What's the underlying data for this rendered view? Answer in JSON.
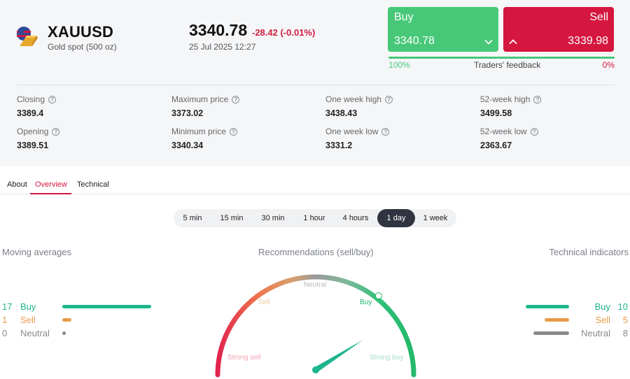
{
  "instrument": {
    "symbol": "XAUUSD",
    "subtitle": "Gold spot (500 oz)",
    "icon": "gold-bar-us-flag-icon"
  },
  "quote": {
    "price": "3340.78",
    "change": "-28.42 (-0.01%)",
    "timestamp": "25 Jul 2025 12:27"
  },
  "trade": {
    "buy_label": "Buy",
    "buy_price": "3340.78",
    "sell_label": "Sell",
    "sell_price": "3339.98"
  },
  "feedback": {
    "buy_percent": "100%",
    "label": "Traders' feedback",
    "sell_percent": "0%",
    "buy_fraction": 1.0
  },
  "stats": [
    {
      "label": "Closing",
      "value": "3389.4"
    },
    {
      "label": "Maximum price",
      "value": "3373.02"
    },
    {
      "label": "One week high",
      "value": "3438.43"
    },
    {
      "label": "52-week high",
      "value": "3499.58"
    },
    {
      "label": "Opening",
      "value": "3389.51"
    },
    {
      "label": "Minimum price",
      "value": "3340.34"
    },
    {
      "label": "One week low",
      "value": "3331.2"
    },
    {
      "label": "52-week low",
      "value": "2363.67"
    }
  ],
  "tabs": [
    {
      "label": "About"
    },
    {
      "label": "Overview",
      "active": true
    },
    {
      "label": "Technical"
    }
  ],
  "periods": [
    {
      "label": "5 min"
    },
    {
      "label": "15 min"
    },
    {
      "label": "30 min"
    },
    {
      "label": "1 hour"
    },
    {
      "label": "4 hours"
    },
    {
      "label": "1 day",
      "active": true
    },
    {
      "label": "1 week"
    }
  ],
  "moving_averages": {
    "title": "Moving averages",
    "buy": {
      "count": "17",
      "label": "Buy"
    },
    "sell": {
      "count": "1",
      "label": "Sell"
    },
    "neutral": {
      "count": "0",
      "label": "Neutral"
    }
  },
  "recommendations": {
    "title": "Recommendations (sell/buy)",
    "labels": {
      "strong_sell": "Strong sell",
      "sell": "Sell",
      "neutral": "Neutral",
      "buy": "Buy",
      "strong_buy": "Strong buy"
    },
    "needle_fraction": 0.82
  },
  "technical_indicators": {
    "title": "Technical indicators",
    "buy": {
      "count": "10",
      "label": "Buy"
    },
    "sell": {
      "count": "5",
      "label": "Sell"
    },
    "neutral": {
      "count": "8",
      "label": "Neutral"
    }
  },
  "colors": {
    "buy": "#47c878",
    "sell": "#d5173f",
    "teal": "#1db58e",
    "orange": "#e89b4a",
    "neutral": "#8a8a8a"
  }
}
